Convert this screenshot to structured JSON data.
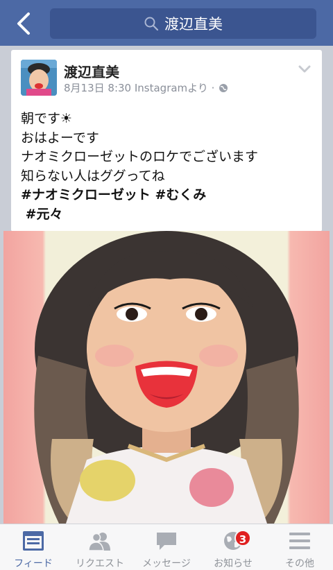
{
  "search": {
    "query": "渡辺直美"
  },
  "post": {
    "author": "渡辺直美",
    "meta": "8月13日 8:30 Instagramより ·",
    "lines": [
      "朝です☀",
      "おはよーです",
      "ナオミクローゼットのロケでございます",
      "知らない人はググってね"
    ],
    "hashtags_line1": "#ナオミクローゼット #むくみ",
    "hashtags_line2": " #元々"
  },
  "tabs": [
    {
      "label": "フィード",
      "icon": "feed-icon",
      "active": true
    },
    {
      "label": "リクエスト",
      "icon": "friend-requests-icon"
    },
    {
      "label": "メッセージ",
      "icon": "messages-icon"
    },
    {
      "label": "お知らせ",
      "icon": "globe-icon",
      "badge": "3"
    },
    {
      "label": "その他",
      "icon": "menu-icon"
    }
  ],
  "colors": {
    "brand": "#4c69a5",
    "badge": "#e02020"
  }
}
